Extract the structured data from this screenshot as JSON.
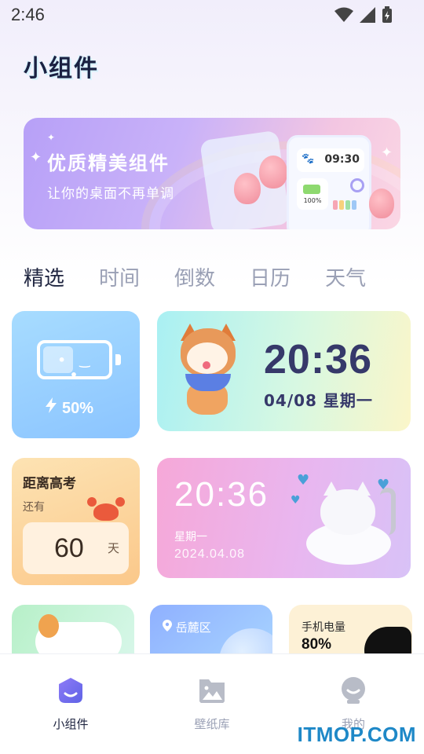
{
  "status_bar": {
    "time": "2:46",
    "wifi_icon": "wifi-icon",
    "signal_icon": "signal-icon",
    "battery_icon": "battery-charging-icon"
  },
  "page": {
    "title": "小组件"
  },
  "banner": {
    "title": "优质精美组件",
    "subtitle": "让你的桌面不再单调",
    "preview_time": "09:30",
    "preview_battery": "100%"
  },
  "tabs": [
    {
      "label": "精选",
      "active": true
    },
    {
      "label": "时间",
      "active": false
    },
    {
      "label": "倒数",
      "active": false
    },
    {
      "label": "日历",
      "active": false
    },
    {
      "label": "天气",
      "active": false
    }
  ],
  "widgets": {
    "battery": {
      "face": "• ‿ •",
      "percent": "50%"
    },
    "clock_dog": {
      "time": "20:36",
      "date": "04/08  星期一"
    },
    "exam": {
      "title": "距离高考",
      "sub": "还有",
      "days": "60",
      "unit": "天"
    },
    "clock_cat": {
      "time": "20:36",
      "day": "星期一",
      "date": "2024.04.08"
    },
    "weather": {
      "location": "岳麓区"
    },
    "phone_battery": {
      "label": "手机电量",
      "percent": "80%"
    }
  },
  "bottom_nav": [
    {
      "label": "小组件",
      "icon": "widget-face-icon",
      "active": true
    },
    {
      "label": "壁纸库",
      "icon": "image-gallery-icon",
      "active": false
    },
    {
      "label": "我的",
      "icon": "profile-icon",
      "active": false
    }
  ],
  "watermark": "ITMOP.COM",
  "colors": {
    "accent": "#7a6ff0",
    "active_text": "#1f2540",
    "inactive_text": "#9aa0b5",
    "watermark": "#1e88c7"
  }
}
